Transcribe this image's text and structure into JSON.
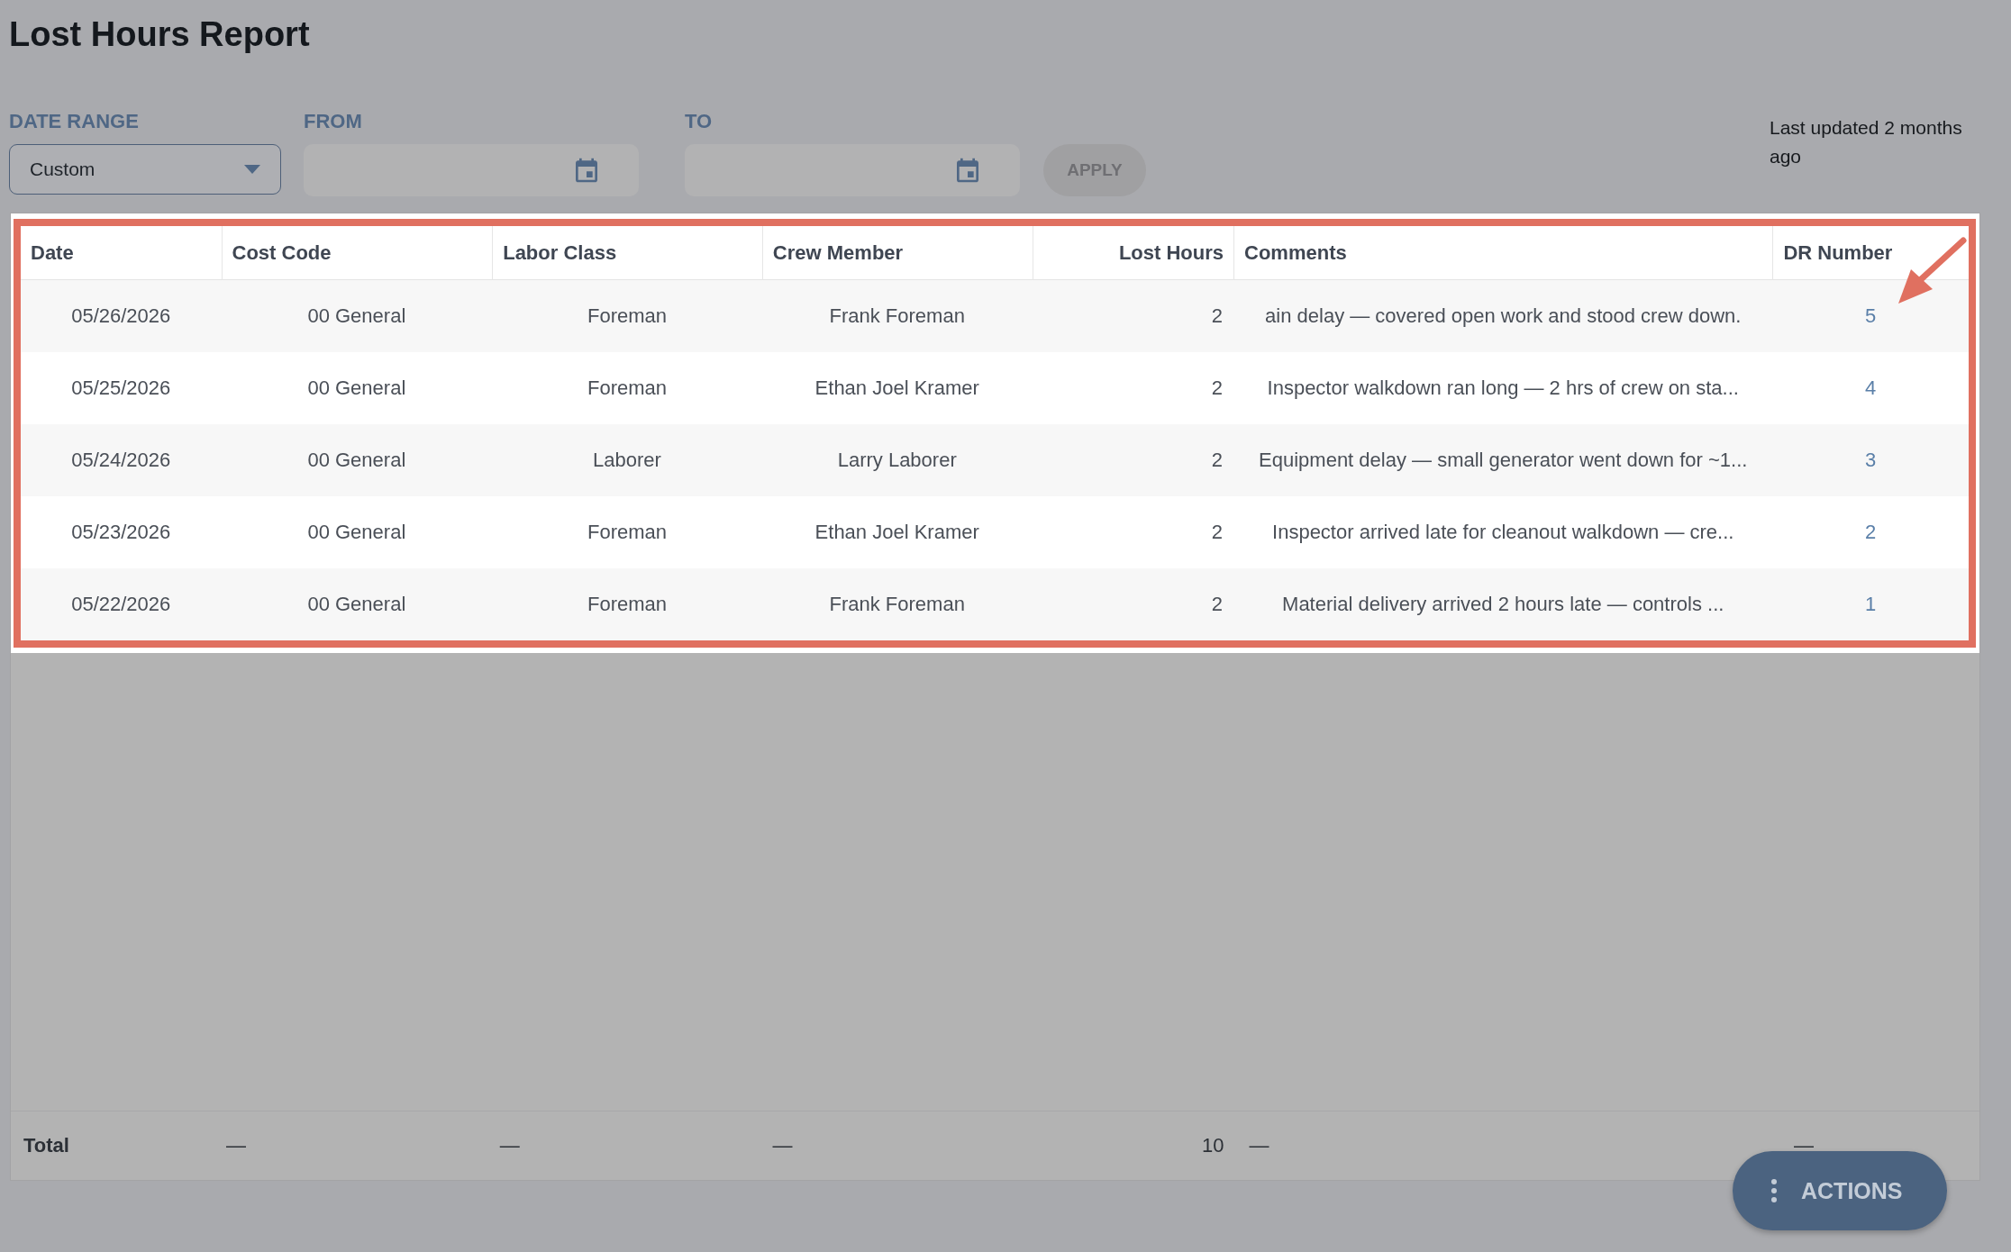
{
  "title": "Lost Hours Report",
  "filters": {
    "date_range": {
      "label": "DATE RANGE",
      "value": "Custom"
    },
    "from": {
      "label": "FROM"
    },
    "to": {
      "label": "TO"
    },
    "apply_button": {
      "label": "APPLY",
      "disabled": true
    }
  },
  "last_updated": "Last updated 2 months ago",
  "table": {
    "columns": [
      "Date",
      "Cost Code",
      "Labor Class",
      "Crew Member",
      "Lost Hours",
      "Comments",
      "DR Number"
    ],
    "rows": [
      {
        "cells": [
          "05/26/2026",
          "00 General",
          "Foreman",
          "Frank Foreman",
          "2",
          "ain delay — covered open work and stood crew down.",
          "5"
        ]
      },
      {
        "cells": [
          "05/25/2026",
          "00 General",
          "Foreman",
          "Ethan Joel Kramer",
          "2",
          "Inspector walkdown ran long — 2 hrs of crew on sta...",
          "4"
        ]
      },
      {
        "cells": [
          "05/24/2026",
          "00 General",
          "Laborer",
          "Larry Laborer",
          "2",
          "Equipment delay — small generator went down for ~1...",
          "3"
        ]
      },
      {
        "cells": [
          "05/23/2026",
          "00 General",
          "Foreman",
          "Ethan Joel Kramer",
          "2",
          "Inspector arrived late for cleanout walkdown — cre...",
          "2"
        ]
      },
      {
        "cells": [
          "05/22/2026",
          "00 General",
          "Foreman",
          "Frank Foreman",
          "2",
          "Material delivery arrived 2 hours late — controls ...",
          "1"
        ]
      }
    ]
  },
  "totals": {
    "label": "Total",
    "values": [
      "—",
      "—",
      "—",
      "10",
      "—",
      "—"
    ]
  },
  "actions_button": {
    "label": "ACTIONS"
  }
}
